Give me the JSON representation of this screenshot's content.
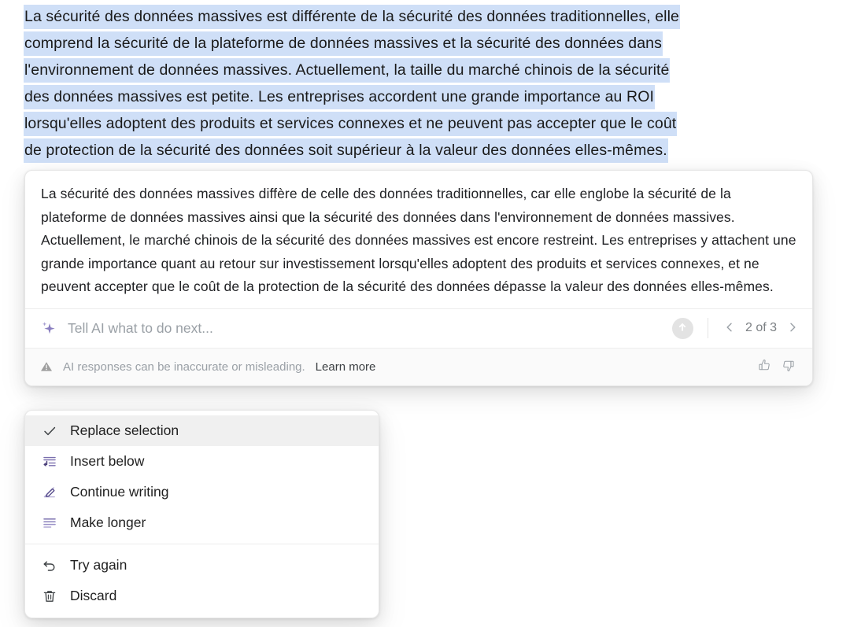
{
  "source_selection": {
    "name": "selected-source-paragraph",
    "highlight_color": "#cfdff7",
    "lines": [
      "La sécurité des données massives est différente de la sécurité des données traditionnelles, elle",
      "comprend la sécurité de la plateforme de données massives et la sécurité des données dans",
      "l'environnement de données massives. Actuellement, la taille du marché chinois de la sécurité",
      "des données massives est petite. Les entreprises accordent une grande importance au ROI",
      "lorsqu'elles adoptent des produits et services connexes et ne peuvent pas accepter que le coût",
      "de protection de la sécurité des données soit supérieur à la valeur des données elles-mêmes."
    ]
  },
  "ai_card": {
    "response_text": "La sécurité des données massives diffère de celle des données traditionnelles, car elle englobe la sécurité de la plateforme de données massives ainsi que la sécurité des données dans l'environnement de données massives. Actuellement, le marché chinois de la sécurité des données massives est encore restreint. Les entreprises y attachent une grande importance quant au retour sur investissement lorsqu'elles adoptent des produits et services connexes, et ne peuvent accepter que le coût de la protection de la sécurité des données dépasse la valeur des données elles-mêmes.",
    "prompt": {
      "icon": "sparkle-icon",
      "icon_color": "#8a7fc0",
      "value": "",
      "placeholder": "Tell AI what to do next...",
      "submit_icon": "arrow-up-icon",
      "submit_bg": "#e3e3e3"
    },
    "pagination": {
      "prev_icon": "chevron-left-icon",
      "next_icon": "chevron-right-icon",
      "label": "2 of 3",
      "current": 2,
      "total": 3
    },
    "disclaimer": {
      "icon": "warning-triangle-icon",
      "text": "AI responses can be inaccurate or misleading.",
      "link_label": "Learn more"
    },
    "feedback": {
      "up_icon": "thumbs-up-icon",
      "down_icon": "thumbs-down-icon"
    }
  },
  "menu": {
    "name": "ai-actions-menu",
    "groups": [
      {
        "items": [
          {
            "label": "Replace selection",
            "icon": "check-icon",
            "selected": true,
            "icon_color": "#3c4043"
          },
          {
            "label": "Insert below",
            "icon": "insert-below-icon",
            "selected": false,
            "icon_color": "#7a6fae"
          },
          {
            "label": "Continue writing",
            "icon": "pencil-icon",
            "selected": false,
            "icon_color": "#7a6fae"
          },
          {
            "label": "Make longer",
            "icon": "make-longer-icon",
            "selected": false,
            "icon_color": "#7a6fae"
          }
        ]
      },
      {
        "items": [
          {
            "label": "Try again",
            "icon": "undo-arrow-icon",
            "selected": false,
            "icon_color": "#3c4043"
          },
          {
            "label": "Discard",
            "icon": "trash-icon",
            "selected": false,
            "icon_color": "#3c4043"
          }
        ]
      }
    ]
  }
}
